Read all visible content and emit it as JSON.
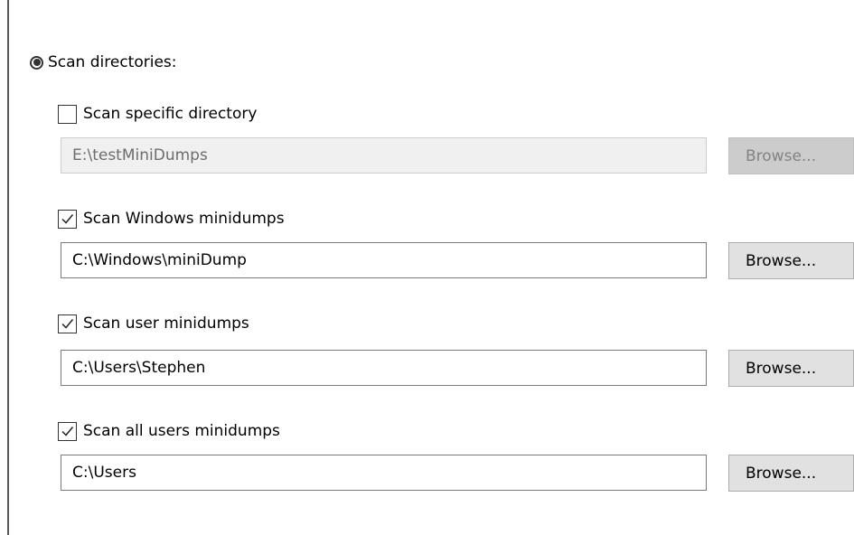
{
  "scan_directories": {
    "label": "Scan directories:",
    "selected": true
  },
  "sections": [
    {
      "checkbox_label": "Scan specific directory",
      "checked": false,
      "path": "E:\\testMiniDumps",
      "enabled": false,
      "browse_label": "Browse..."
    },
    {
      "checkbox_label": "Scan Windows minidumps",
      "checked": true,
      "path": "C:\\Windows\\miniDump",
      "enabled": true,
      "browse_label": "Browse..."
    },
    {
      "checkbox_label": "Scan user minidumps",
      "checked": true,
      "path": "C:\\Users\\Stephen",
      "enabled": true,
      "browse_label": "Browse..."
    },
    {
      "checkbox_label": "Scan all users minidumps",
      "checked": true,
      "path": "C:\\Users",
      "enabled": true,
      "browse_label": "Browse..."
    }
  ]
}
